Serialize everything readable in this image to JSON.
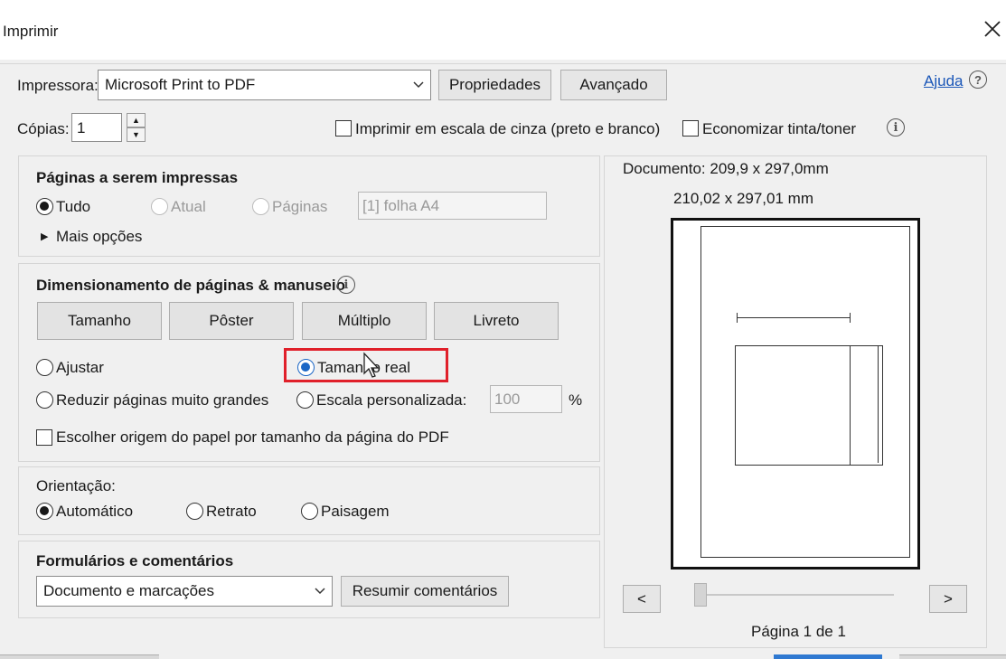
{
  "window": {
    "title": "Imprimir",
    "close_icon": "close-icon"
  },
  "printer": {
    "label": "Impressora:",
    "selected": "Microsoft Print to PDF",
    "properties_label": "Propriedades",
    "advanced_label": "Avançado",
    "help_label": "Ajuda"
  },
  "copies": {
    "label": "Cópias:",
    "value": "1"
  },
  "options": {
    "grayscale_label": "Imprimir em escala de cinza (preto e branco)",
    "save_ink_label": "Economizar tinta/toner"
  },
  "pages": {
    "heading": "Páginas a serem impressas",
    "all_label": "Tudo",
    "current_label": "Atual",
    "pages_label": "Páginas",
    "pages_value": "[1] folha A4",
    "more_options_label": "Mais opções"
  },
  "sizing": {
    "heading": "Dimensionamento de páginas & manuseio",
    "tab_size": "Tamanho",
    "tab_poster": "Pôster",
    "tab_multiple": "Múltiplo",
    "tab_booklet": "Livreto",
    "fit_label": "Ajustar",
    "actual_size_label": "Tamanho real",
    "shrink_label": "Reduzir páginas muito grandes",
    "custom_scale_label": "Escala personalizada:",
    "custom_scale_value": "100",
    "percent_label": "%",
    "paper_source_label": "Escolher origem do papel por tamanho da página do PDF"
  },
  "orientation": {
    "heading": "Orientação:",
    "auto_label": "Automático",
    "portrait_label": "Retrato",
    "landscape_label": "Paisagem"
  },
  "forms": {
    "heading": "Formulários e comentários",
    "selected": "Documento e marcações",
    "summarize_label": "Resumir comentários"
  },
  "preview": {
    "document_size": "Documento: 209,9 x 297,0mm",
    "paper_size": "210,02 x 297,01 mm",
    "prev_label": "<",
    "next_label": ">",
    "page_indicator": "Página 1 de 1"
  },
  "colors": {
    "highlight": "#e0202a",
    "selected_radio": "#1a66c6",
    "link": "#1b57b8"
  }
}
